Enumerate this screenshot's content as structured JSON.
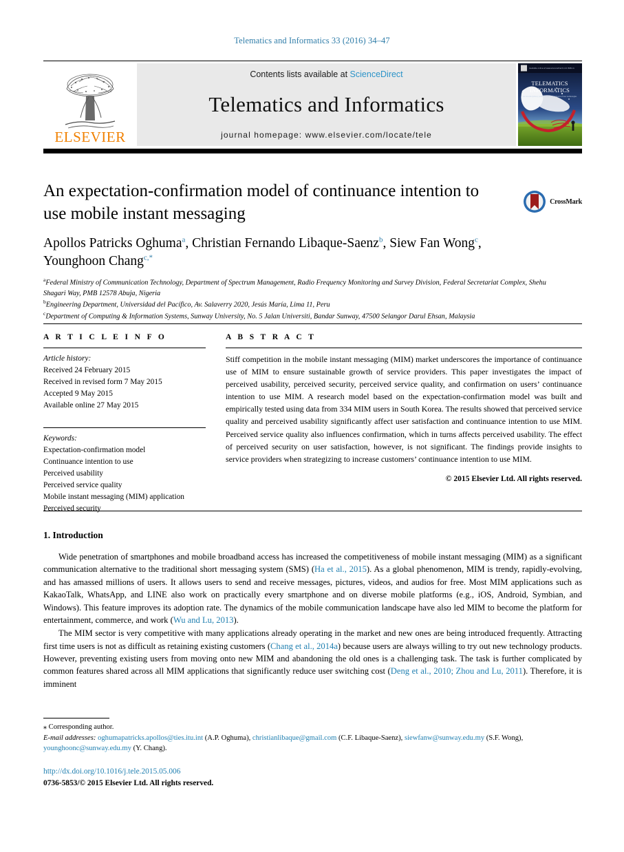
{
  "running_head": "Telematics and Informatics 33 (2016) 34–47",
  "banner": {
    "contents_prefix": "Contents lists available at ",
    "sciencedirect": "ScienceDirect",
    "journal_name": "Telematics and Informatics",
    "homepage": "journal homepage: www.elsevier.com/locate/tele",
    "elsevier_wordmark": "ELSEVIER",
    "cover_title_line1": "TELEMATICS and",
    "cover_title_line2": "INFORMATICS"
  },
  "article": {
    "title": "An expectation-confirmation model of continuance intention to use mobile instant messaging",
    "crossmark_label": "CrossMark",
    "authors_html": "Apollos Patricks Oghuma <sup>a</sup>, Christian Fernando Libaque-Saenz <sup>b</sup>, Siew Fan Wong <sup>c</sup>, Younghoon Chang <sup>c,*</sup>",
    "affiliations": [
      {
        "marker": "a",
        "text": "Federal Ministry of Communication Technology, Department of Spectrum Management, Radio Frequency Monitoring and Survey Division, Federal Secretariat Complex, Shehu Shagari Way, PMB 12578 Abuja, Nigeria"
      },
      {
        "marker": "b",
        "text": "Engineering Department, Universidad del Pacífico, Av. Salaverry 2020, Jesús María, Lima 11, Peru"
      },
      {
        "marker": "c",
        "text": "Department of Computing & Information Systems, Sunway University, No. 5 Jalan Universiti, Bandar Sunway, 47500 Selangor Darul Ehsan, Malaysia"
      }
    ]
  },
  "info": {
    "heading": "A R T I C L E    I N F O",
    "history_label": "Article history:",
    "history": [
      "Received 24 February 2015",
      "Received in revised form 7 May 2015",
      "Accepted 9 May 2015",
      "Available online 27 May 2015"
    ],
    "keywords_label": "Keywords:",
    "keywords": [
      "Expectation-confirmation model",
      "Continuance intention to use",
      "Perceived usability",
      "Perceived service quality",
      "Mobile instant messaging (MIM) application",
      "Perceived security"
    ]
  },
  "abstract": {
    "heading": "A B S T R A C T",
    "text": "Stiff competition in the mobile instant messaging (MIM) market underscores the importance of continuance use of MIM to ensure sustainable growth of service providers. This paper investigates the impact of perceived usability, perceived security, perceived service quality, and confirmation on users’ continuance intention to use MIM. A research model based on the expectation-confirmation model was built and empirically tested using data from 334 MIM users in South Korea. The results showed that perceived service quality and perceived usability significantly affect user satisfaction and continuance intention to use MIM. Perceived service quality also influences confirmation, which in turns affects perceived usability. The effect of perceived security on user satisfaction, however, is not significant. The findings provide insights to service providers when strategizing to increase customers’ continuance intention to use MIM.",
    "copyright": "© 2015 Elsevier Ltd. All rights reserved."
  },
  "introduction": {
    "heading": "1. Introduction",
    "paragraph1_part1": "Wide penetration of smartphones and mobile broadband access has increased the competitiveness of mobile instant messaging (MIM) as a significant communication alternative to the traditional short messaging system (SMS) (",
    "paragraph1_cite1": "Ha et al., 2015",
    "paragraph1_part2": "). As a global phenomenon, MIM is trendy, rapidly-evolving, and has amassed millions of users. It allows users to send and receive messages, pictures, videos, and audios for free. Most MIM applications such as KakaoTalk, WhatsApp, and LINE also work on practically every smartphone and on diverse mobile platforms (e.g., iOS, Android, Symbian, and Windows). This feature improves its adoption rate. The dynamics of the mobile communication landscape have also led MIM to become the platform for entertainment, commerce, and work (",
    "paragraph1_cite2": "Wu and Lu, 2013",
    "paragraph1_part3": ").",
    "paragraph2_part1": "The MIM sector is very competitive with many applications already operating in the market and new ones are being introduced frequently. Attracting first time users is not as difficult as retaining existing customers (",
    "paragraph2_cite1": "Chang et al., 2014a",
    "paragraph2_part2": ") because users are always willing to try out new technology products. However, preventing existing users from moving onto new MIM and abandoning the old ones is a challenging task. The task is further complicated by common features shared across all MIM applications that significantly reduce user switching cost (",
    "paragraph2_cite2": "Deng et al., 2010; Zhou and Lu, 2011",
    "paragraph2_part3": "). Therefore, it is imminent"
  },
  "footnote": {
    "corresponding": "Corresponding author.",
    "email_label": "E-mail addresses:",
    "emails": [
      {
        "address": "oghumapatricks.apollos@ties.itu.int",
        "owner": "(A.P. Oghuma)"
      },
      {
        "address": "christianlibaque@gmail.com",
        "owner": "(C.F. Libaque-Saenz)"
      },
      {
        "address": "siewfanw@sunway.edu.my",
        "owner": "(S.F. Wong)"
      },
      {
        "address": "younghoonc@sunway.edu.my",
        "owner": "(Y. Chang)"
      }
    ],
    "doi": "http://dx.doi.org/10.1016/j.tele.2015.05.006",
    "issn": "0736-5853/© 2015 Elsevier Ltd. All rights reserved."
  },
  "colors": {
    "link_blue": "#1f7fb0",
    "sciencedirect_blue": "#2b93c8",
    "elsevier_orange": "#F08000",
    "banner_gray": "#e9e9e9"
  }
}
